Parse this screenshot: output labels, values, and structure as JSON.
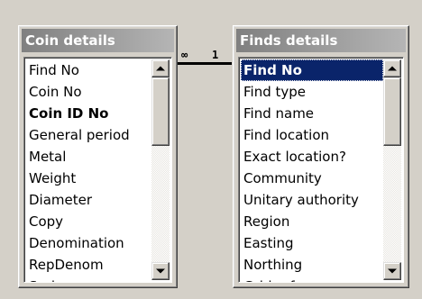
{
  "left_table": {
    "title": "Coin details",
    "fields": [
      {
        "label": "Find No"
      },
      {
        "label": "Coin No"
      },
      {
        "label": "Coin ID No",
        "bold": true
      },
      {
        "label": "General period"
      },
      {
        "label": "Metal"
      },
      {
        "label": "Weight"
      },
      {
        "label": "Diameter"
      },
      {
        "label": "Copy"
      },
      {
        "label": "Denomination"
      },
      {
        "label": "RepDenom"
      },
      {
        "label": "Series"
      }
    ]
  },
  "right_table": {
    "title": "Finds details",
    "fields": [
      {
        "label": "Find No",
        "selected": true,
        "bold": true
      },
      {
        "label": "Find type"
      },
      {
        "label": "Find name"
      },
      {
        "label": "Find location"
      },
      {
        "label": "Exact location?"
      },
      {
        "label": "Community"
      },
      {
        "label": "Unitary authority"
      },
      {
        "label": "Region"
      },
      {
        "label": "Easting"
      },
      {
        "label": "Northing"
      },
      {
        "label": "Grid reference"
      }
    ]
  },
  "relationship": {
    "many_symbol": "∞",
    "one_symbol": "1"
  },
  "icons": {
    "scroll_up": "triangle-up",
    "scroll_down": "triangle-down"
  },
  "colors": {
    "title_bar_start": "#808080",
    "title_bar_end": "#b5b5b5",
    "selection": "#0a246a",
    "window_face": "#d4d0c8"
  }
}
